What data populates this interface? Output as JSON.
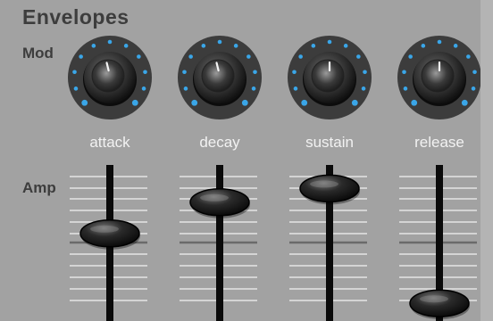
{
  "panel": {
    "title": "Envelopes",
    "mod_label": "Mod",
    "amp_label": "Amp"
  },
  "knobs": [
    {
      "label": "attack",
      "value": 0.45
    },
    {
      "label": "decay",
      "value": 0.45
    },
    {
      "label": "sustain",
      "value": 0.5
    },
    {
      "label": "release",
      "value": 0.5
    }
  ],
  "faders": [
    {
      "name": "attack",
      "value": 0.58
    },
    {
      "name": "decay",
      "value": 0.83
    },
    {
      "name": "sustain",
      "value": 0.94
    },
    {
      "name": "release",
      "value": 0.02
    }
  ],
  "colors": {
    "panel": "#a2a2a2",
    "text": "#3d3d3d",
    "label_light": "#f2f2f2",
    "led": "#3aa6e8",
    "knob_ring": "#3c3c3c"
  }
}
